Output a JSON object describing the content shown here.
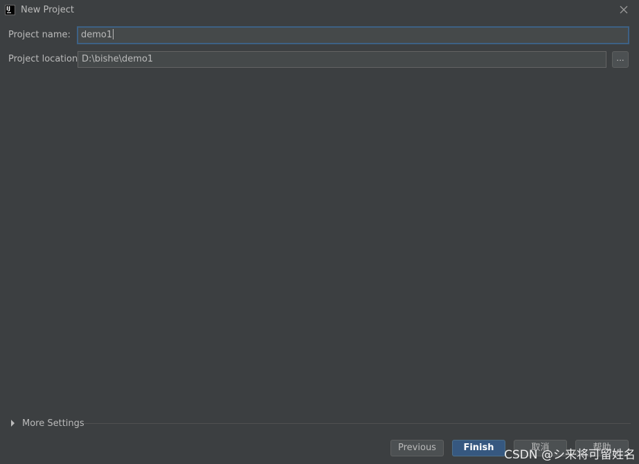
{
  "window": {
    "title": "New Project",
    "app_icon_text": "IJ"
  },
  "form": {
    "project_name_label": "Project name:",
    "project_name_value": "demo1",
    "project_location_label": "Project location:",
    "project_location_value": "D:\\bishe\\demo1",
    "browse_label": "..."
  },
  "more_settings": {
    "label": "More Settings",
    "expanded": false
  },
  "buttons": {
    "previous_label": "Previous",
    "finish_label": "Finish",
    "cancel_label": "取消",
    "help_label": "帮助"
  },
  "watermark": {
    "text": "CSDN @シ来将可留姓名"
  },
  "colors": {
    "background": "#3c3f41",
    "input_background": "#45494a",
    "focus_border": "#3d6185",
    "primary_button": "#365880",
    "text": "#bbbbbb"
  },
  "icons": {
    "app": "intellij-idea-icon",
    "close": "close-icon",
    "expand": "triangle-right-icon"
  }
}
